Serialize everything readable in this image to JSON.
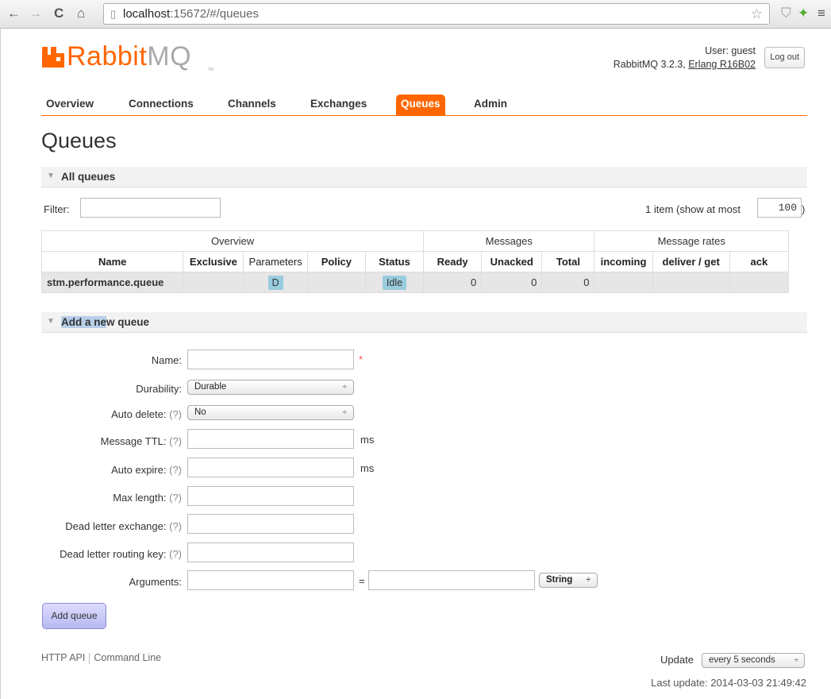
{
  "browser": {
    "back_glyph": "←",
    "forward_glyph": "→",
    "reload_glyph": "C",
    "home_glyph": "⌂",
    "url_host": "localhost",
    "url_rest": ":15672/#/queues",
    "star_glyph": "☆",
    "shield_glyph": "⛉",
    "tree_glyph": "✦",
    "menu_glyph": "≡"
  },
  "header": {
    "logo_rabbit": "Rabbit",
    "logo_mq": "MQ",
    "logo_tm": "TM",
    "user_label": "User: guest",
    "version_text": "RabbitMQ 3.2.3, ",
    "erlang_text": "Erlang R16B02",
    "logout": "Log out"
  },
  "tabs": [
    {
      "label": "Overview"
    },
    {
      "label": "Connections"
    },
    {
      "label": "Channels"
    },
    {
      "label": "Exchanges"
    },
    {
      "label": "Queues"
    },
    {
      "label": "Admin"
    }
  ],
  "page_title": "Queues",
  "all_queues": {
    "title": "All queues",
    "filter_label": "Filter:",
    "filter_value": "",
    "page_info": "1 item (show at most",
    "page_size": "100",
    "close_paren": ")"
  },
  "table": {
    "groups": [
      "Overview",
      "Messages",
      "Message rates"
    ],
    "columns": [
      "Name",
      "Exclusive",
      "Parameters",
      "Policy",
      "Status",
      "Ready",
      "Unacked",
      "Total",
      "incoming",
      "deliver / get",
      "ack"
    ],
    "rows": [
      {
        "name": "stm.performance.queue",
        "exclusive": "",
        "parameters": "D",
        "policy": "",
        "status": "Idle",
        "ready": "0",
        "unacked": "0",
        "total": "0",
        "incoming": "",
        "deliver_get": "",
        "ack": ""
      }
    ]
  },
  "add_queue": {
    "title_hl": "Add a ne",
    "title_rest": "w queue",
    "name_label": "Name:",
    "required_mark": "*",
    "durability_label": "Durability:",
    "durability_value": "Durable",
    "auto_delete_label": "Auto delete:",
    "auto_delete_value": "No",
    "message_ttl_label": "Message TTL:",
    "auto_expire_label": "Auto expire:",
    "max_length_label": "Max length:",
    "dlx_label": "Dead letter exchange:",
    "dlrk_label": "Dead letter routing key:",
    "arguments_label": "Arguments:",
    "arguments_eq": "=",
    "arguments_type": "String",
    "help": "(?)",
    "unit_ms": "ms",
    "select_arrow": "÷",
    "submit": "Add queue"
  },
  "footer": {
    "http_api": "HTTP API",
    "command_line": "Command Line",
    "update_label": "Update",
    "update_value": "every 5 seconds",
    "last_update": "Last update: 2014-03-03 21:49:42"
  },
  "colors": {
    "accent": "#ff6600",
    "badge": "#99ccdd",
    "button": "#b8b8f2"
  }
}
